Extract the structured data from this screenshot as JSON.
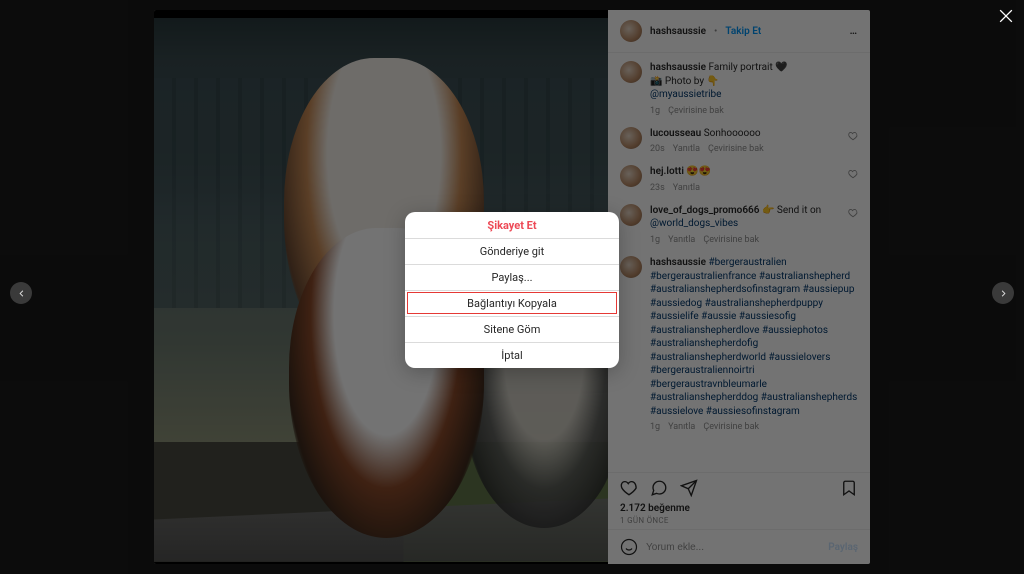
{
  "post": {
    "author": "hashsaussie",
    "follow_label": "Takip Et",
    "separator": "•",
    "more_label": "…",
    "media_alt": "Three Australian Shepherd dogs posing on a driveway"
  },
  "caption": {
    "username": "hashsaussie",
    "lines": [
      "Family portrait 🖤",
      "📸 Photo by 👇",
      "@myaussietribe"
    ],
    "age": "1g",
    "translate": "Çevirisine bak"
  },
  "comments": [
    {
      "username": "lucousseau",
      "text": "Sonhoooooo",
      "age": "20s",
      "reply": "Yanıtla",
      "translate": "Çevirisine bak"
    },
    {
      "username": "hej.lotti",
      "text": "😍😍",
      "age": "23s",
      "reply": "Yanıtla",
      "translate": ""
    },
    {
      "username": "love_of_dogs_promo666",
      "text": "👉 Send it on ",
      "mention": "@world_dogs_vibes",
      "age": "1g",
      "reply": "Yanıtla",
      "translate": "Çevirisine bak"
    }
  ],
  "hashtag_comment": {
    "username": "hashsaussie",
    "tags": "#bergeraustralien #bergeraustralienfrance #australianshepherd #australianshepherdsofinstagram #aussiepup #aussiedog #australianshepherdpuppy #aussielife #aussie #aussiesofig #australianshepherdlove #aussiephotos #australianshepherdofig #australianshepherdworld #aussielovers #bergeraustraliennoirtri #bergeraustravnbleumarle #australianshepherddog #australianshepherds #aussielove #aussiesofinstagram",
    "age": "1g",
    "reply": "Yanıtla",
    "translate": "Çevirisine bak"
  },
  "actions": {
    "likes": "2.172 beğenme",
    "age": "1 gün önce"
  },
  "add_comment": {
    "placeholder": "Yorum ekle...",
    "share": "Paylaş"
  },
  "menu": {
    "report": "Şikayet Et",
    "goto": "Gönderiye git",
    "share": "Paylaş...",
    "copy_link": "Bağlantıyı Kopyala",
    "embed": "Sitene Göm",
    "cancel": "İptal"
  },
  "nav": {
    "prev": "Önceki",
    "next": "Sonraki",
    "close": "Kapat"
  }
}
